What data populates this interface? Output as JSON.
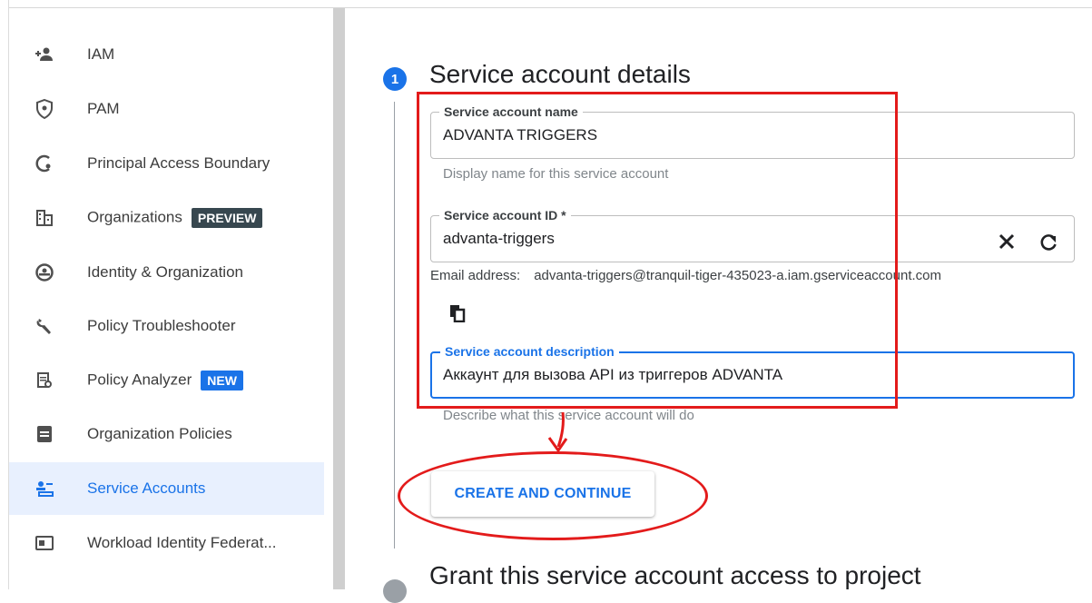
{
  "sidebar": {
    "items": [
      {
        "label": "IAM",
        "icon": "add-person-icon"
      },
      {
        "label": "PAM",
        "icon": "shield-icon"
      },
      {
        "label": "Principal Access Boundary",
        "icon": "boundary-icon"
      },
      {
        "label": "Organizations",
        "icon": "organizations-icon",
        "badge": "PREVIEW"
      },
      {
        "label": "Identity & Organization",
        "icon": "account-circle-icon"
      },
      {
        "label": "Policy Troubleshooter",
        "icon": "wrench-icon"
      },
      {
        "label": "Policy Analyzer",
        "icon": "document-search-icon",
        "badge": "NEW"
      },
      {
        "label": "Organization Policies",
        "icon": "policy-document-icon"
      },
      {
        "label": "Service Accounts",
        "icon": "service-account-icon",
        "active": true
      },
      {
        "label": "Workload Identity Federat...",
        "icon": "id-card-icon"
      }
    ]
  },
  "step1": {
    "number": "1",
    "title": "Service account details"
  },
  "name_field": {
    "label": "Service account name",
    "value": "ADVANTA TRIGGERS",
    "hint": "Display name for this service account"
  },
  "id_field": {
    "label": "Service account ID *",
    "value": "advanta-triggers"
  },
  "email": {
    "label": "Email address:",
    "value": "advanta-triggers@tranquil-tiger-435023-a.iam.gserviceaccount.com"
  },
  "description_field": {
    "label": "Service account description",
    "value": "Аккаунт для вызова API из триггеров ADVANTA",
    "hint": "Describe what this service account will do"
  },
  "create_button": "CREATE AND CONTINUE",
  "step2": {
    "title": "Grant this service account access to project"
  },
  "colors": {
    "accent": "#1a73e8",
    "annotation_red": "#e31b1b",
    "active_bg": "#e8f0fe",
    "preview_badge": "#37474f"
  }
}
